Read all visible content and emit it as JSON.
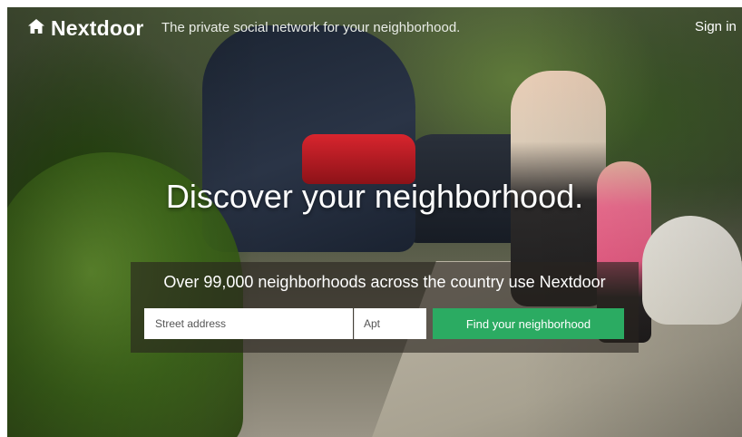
{
  "header": {
    "logo_text": "Nextdoor",
    "logo_icon": "house-icon",
    "tagline": "The private social network for your neighborhood.",
    "signin_label": "Sign in"
  },
  "hero": {
    "headline": "Discover your neighborhood."
  },
  "search": {
    "title": "Over 99,000 neighborhoods across the country use Nextdoor",
    "street_placeholder": "Street address",
    "street_value": "",
    "apt_placeholder": "Apt",
    "apt_value": "",
    "button_label": "Find your neighborhood"
  },
  "colors": {
    "brand_green": "#2bab62",
    "text_white": "#ffffff"
  }
}
